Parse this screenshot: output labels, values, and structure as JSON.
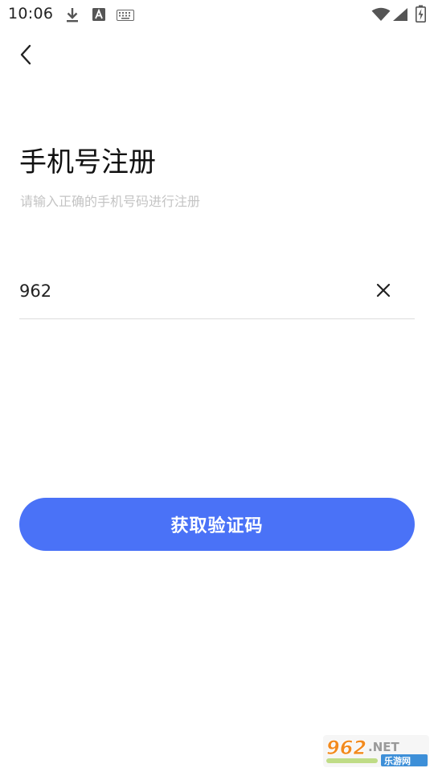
{
  "status_bar": {
    "time": "10:06",
    "icons": [
      "download-icon",
      "text-a-icon",
      "keyboard-icon",
      "wifi-icon",
      "signal-icon",
      "battery-charging-icon"
    ]
  },
  "header": {
    "back_icon": "chevron-left-icon"
  },
  "main": {
    "title": "手机号注册",
    "subtitle": "请输入正确的手机号码进行注册",
    "phone_input": {
      "value": "962",
      "placeholder": ""
    },
    "clear_icon": "close-icon",
    "submit_label": "获取验证码"
  },
  "watermark": {
    "logo_text": "962.NET",
    "logo_subtext": "乐游网"
  },
  "colors": {
    "accent": "#4a72f7",
    "subtitle": "#c4c4c4",
    "divider": "#dcdcdc"
  }
}
